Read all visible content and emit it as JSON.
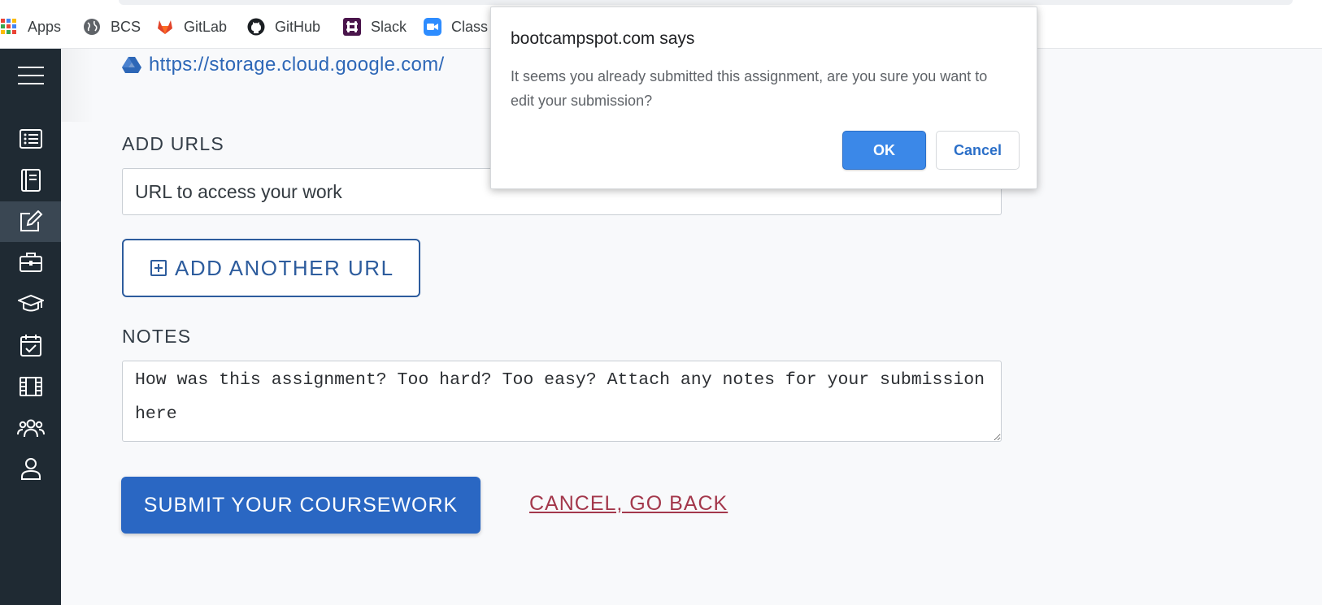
{
  "bookmarks": [
    {
      "label": "Apps",
      "icon": "apps-grid-icon"
    },
    {
      "label": "BCS",
      "icon": "globe-icon"
    },
    {
      "label": "GitLab",
      "icon": "gitlab-icon"
    },
    {
      "label": "GitHub",
      "icon": "github-icon"
    },
    {
      "label": "Slack",
      "icon": "slack-icon"
    },
    {
      "label": "Class",
      "icon": "zoom-icon"
    }
  ],
  "sidebar": {
    "items": [
      {
        "icon": "menu-icon"
      },
      {
        "icon": "list-icon"
      },
      {
        "icon": "book-icon"
      },
      {
        "icon": "edit-icon",
        "active": true
      },
      {
        "icon": "briefcase-icon"
      },
      {
        "icon": "graduation-cap-icon"
      },
      {
        "icon": "calendar-check-icon"
      },
      {
        "icon": "film-icon"
      },
      {
        "icon": "users-icon"
      },
      {
        "icon": "user-icon"
      }
    ]
  },
  "main": {
    "submitted_link": "https://storage.cloud.google.com/",
    "urls_label": "ADD URLS",
    "url_placeholder": "URL to access your work",
    "add_url_label": "ADD ANOTHER URL",
    "notes_label": "NOTES",
    "notes_placeholder": "How was this assignment? Too hard? Too easy? Attach any notes for your submission here",
    "submit_label": "SUBMIT YOUR COURSEWORK",
    "cancel_label": "CANCEL, GO BACK"
  },
  "dialog": {
    "title": "bootcampspot.com says",
    "message": "It seems you already submitted this assignment, are you sure you want to edit your submission?",
    "ok_label": "OK",
    "cancel_label": "Cancel"
  },
  "colors": {
    "sidebar_bg": "#1f2a33",
    "sidebar_active": "#3a4753",
    "primary": "#2a67c3",
    "link": "#2d67b7",
    "cancel_link": "#a3374b",
    "dialog_ok": "#3b88e8"
  }
}
